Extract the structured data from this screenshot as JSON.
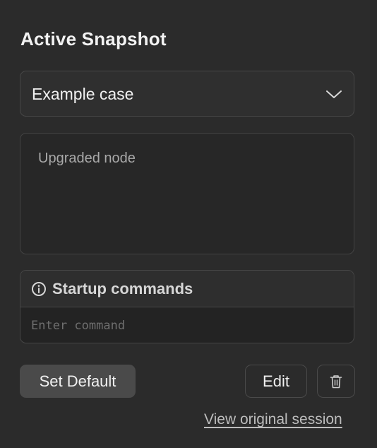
{
  "panel": {
    "title": "Active Snapshot"
  },
  "snapshot_select": {
    "selected": "Example case",
    "icon": "chevron-down-icon"
  },
  "description": {
    "text": "Upgraded node"
  },
  "startup": {
    "label": "Startup commands",
    "icon": "info-icon",
    "input_placeholder": "Enter command",
    "input_value": ""
  },
  "actions": {
    "set_default_label": "Set Default",
    "edit_label": "Edit",
    "delete_icon": "trash-icon"
  },
  "links": {
    "view_original": "View original session"
  },
  "colors": {
    "background": "#2b2b2b",
    "text": "#f0f0f0",
    "muted_text": "#a9a9a9",
    "border": "#474747",
    "primary_button": "#4a4a4a"
  }
}
